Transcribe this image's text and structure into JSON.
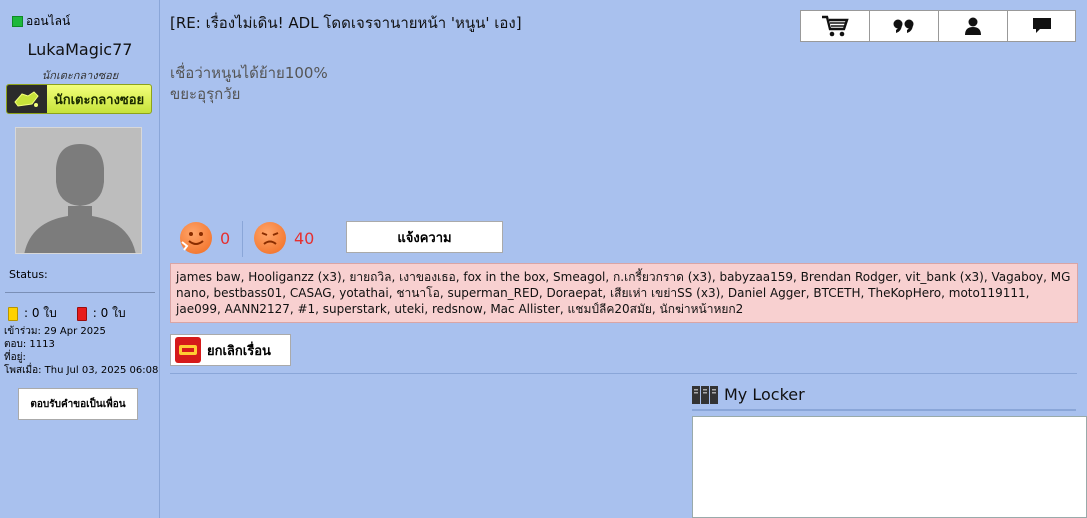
{
  "sidebar": {
    "online_label": "ออนไลน์",
    "username": "LukaMagic77",
    "rank": "นักเตะกลางซอย",
    "rank_badge": "นักเตะกลางซอย",
    "status_label": "Status:",
    "yellow_cards": ": 0 ใบ",
    "red_cards": ": 0 ใบ",
    "joined": "เข้าร่วม: 29 Apr 2025",
    "replies": "ตอบ: 1113",
    "location": "ที่อยู่:",
    "posted": "โพสเมื่อ: Thu Jul 03, 2025 06:08",
    "friend_button": "ตอบรับคำขอเป็นเพื่อน"
  },
  "post": {
    "title": "[RE: เรื่องไม่เดิน! ADL โดดเจรจานายหน้า 'หนูน' เอง]",
    "body_line1": "เชื่อว่าหนูนได้ย้าย100%",
    "body_line2": "ขยะอุรุกวัย"
  },
  "actions": {
    "cart": "cart-icon",
    "quote": "quote-icon",
    "profile": "user-icon",
    "message": "message-icon"
  },
  "reactions": {
    "like_count": "0",
    "dislike_count": "40",
    "report_label": "แจ้งความ"
  },
  "likers": "james baw, Hooliganzz (x3), ยายถวิล, เงาของเธอ, fox in the box, Smeagol, ก.เกรี้ยวกราด (x3), babyzaa159, Brendan Rodger, vit_bank (x3), Vagaboy, MG nano, bestbass01, CASAG, yotathai, ชานาโอ, superman_RED, Doraepat, เสียเห่า เขย่าSS (x3), Daniel Agger, BTCETH, TheKopHero, moto119111, jae099, AANN2127, #1, superstark, uteki, redsnow, Mac Allister, แชมป์ลีค20สมัย, นักฆ่าหน้าหยก2",
  "unfollow_label": "ยกเลิกเรื่อน",
  "locker": {
    "title": "My Locker"
  },
  "colors": {
    "background": "#a9c1ee",
    "likers_bg": "#f8d0d0",
    "react_count": "#e53030",
    "online": "#1db83a"
  }
}
